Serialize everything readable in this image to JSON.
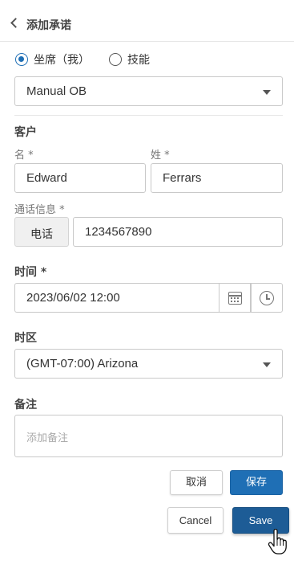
{
  "header": {
    "title": "添加承诺"
  },
  "target": {
    "options": [
      {
        "label": "坐席（我）",
        "checked": true
      },
      {
        "label": "技能",
        "checked": false
      }
    ]
  },
  "campaign": {
    "selected": "Manual OB"
  },
  "customer": {
    "section": "客户",
    "first_name_label": "名 *",
    "first_name_value": "Edward",
    "last_name_label": "姓 *",
    "last_name_value": "Ferrars"
  },
  "contact": {
    "label": "通话信息 *",
    "type": "电话",
    "number": "1234567890"
  },
  "time": {
    "label": "时间 *",
    "value": "2023/06/02 12:00"
  },
  "timezone": {
    "label": "时区",
    "selected": "(GMT-07:00) Arizona"
  },
  "notes": {
    "label": "备注",
    "placeholder": "添加备注"
  },
  "actions_zh": {
    "cancel": "取消",
    "save": "保存"
  },
  "actions_en": {
    "cancel": "Cancel",
    "save": "Save"
  },
  "colors": {
    "accent": "#1f6fb5",
    "accent_dark": "#1d5c96"
  }
}
